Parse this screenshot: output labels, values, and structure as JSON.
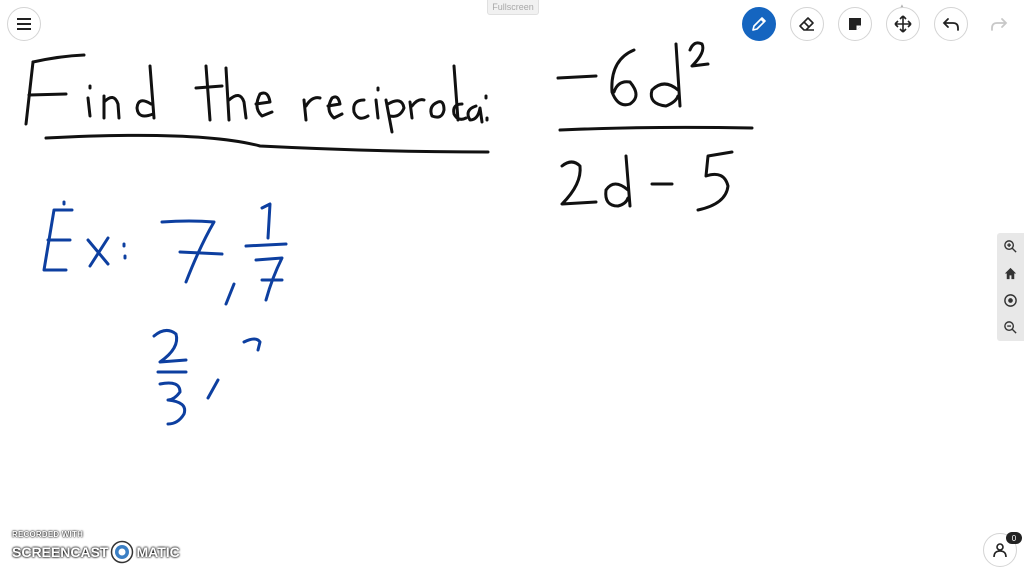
{
  "toolbar": {
    "menu_icon": "hamburger-menu-icon",
    "fullscreen_label": "Fullscreen",
    "tools": [
      {
        "name": "pen",
        "icon": "pen-icon",
        "active": true
      },
      {
        "name": "eraser",
        "icon": "eraser-icon",
        "active": false
      },
      {
        "name": "sticky-note",
        "icon": "sticky-note-icon",
        "active": false
      },
      {
        "name": "move",
        "icon": "move-arrows-icon",
        "active": false
      },
      {
        "name": "undo",
        "icon": "undo-icon",
        "active": false
      },
      {
        "name": "redo",
        "icon": "redo-icon",
        "active": false
      }
    ]
  },
  "zoom_panel": {
    "icons": [
      "zoom-in-icon",
      "home-icon",
      "target-icon",
      "zoom-out-icon"
    ]
  },
  "collaborators": {
    "icon": "users-icon",
    "count": "0"
  },
  "watermark": {
    "line1": "RECORDED WITH",
    "brand_left": "SCREENCAST",
    "brand_right": "MATIC"
  },
  "colors": {
    "accent": "#1565c0",
    "ink_black": "#111111",
    "ink_blue": "#0d3fa0"
  }
}
